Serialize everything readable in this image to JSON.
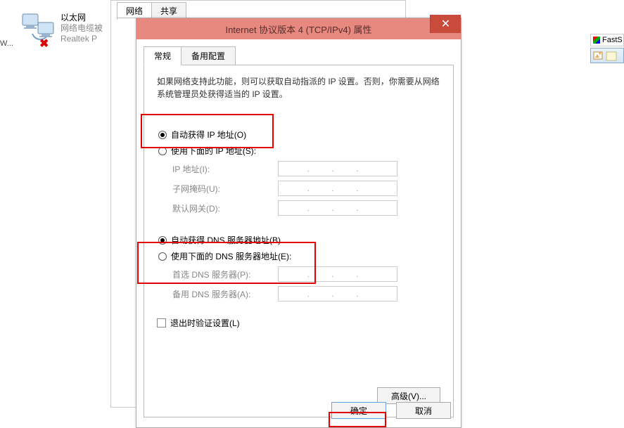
{
  "adapter": {
    "title": "以太网",
    "line2": "网络电缆被",
    "line3": "Realtek P"
  },
  "corner": "W...",
  "backTabs": {
    "tab1": "网络",
    "tab2": "共享"
  },
  "dialog": {
    "title": "Internet 协议版本 4 (TCP/IPv4) 属性",
    "close": "✕",
    "tabs": {
      "general": "常规",
      "alt": "备用配置"
    },
    "description": "如果网络支持此功能，则可以获取自动指派的 IP 设置。否则，你需要从网络系统管理员处获得适当的 IP 设置。",
    "radio": {
      "auto_ip": "自动获得 IP 地址(O)",
      "manual_ip": "使用下面的 IP 地址(S):",
      "auto_dns": "自动获得 DNS 服务器地址(B)",
      "manual_dns": "使用下面的 DNS 服务器地址(E):"
    },
    "fields": {
      "ip": "IP 地址(I):",
      "mask": "子网掩码(U):",
      "gw": "默认网关(D):",
      "dns1": "首选 DNS 服务器(P):",
      "dns2": "备用 DNS 服务器(A):",
      "placeholder": ". . ."
    },
    "checkbox": "退出时验证设置(L)",
    "advanced": "高级(V)...",
    "ok": "确定",
    "cancel": "取消"
  },
  "right": {
    "fs": "FastS"
  }
}
